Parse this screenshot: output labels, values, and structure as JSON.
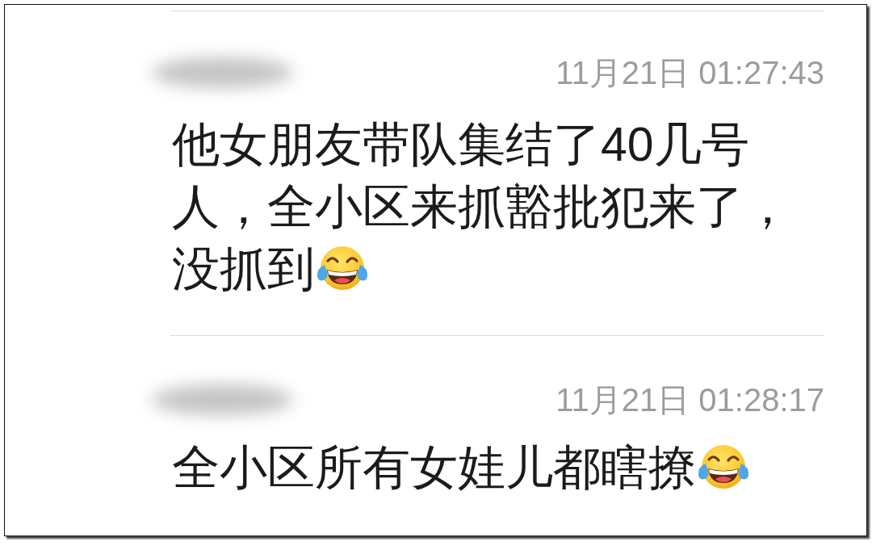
{
  "messages": [
    {
      "sender_hidden": true,
      "time": "11月21日 01:27:43",
      "text": "他女朋友带队集结了40几号人，全小区来抓豁批犯来了，没抓到",
      "trailing_emoji": true
    },
    {
      "sender_hidden": true,
      "time": "11月21日 01:28:17",
      "text": "全小区所有女娃儿都瞎撩",
      "trailing_emoji": true
    }
  ]
}
